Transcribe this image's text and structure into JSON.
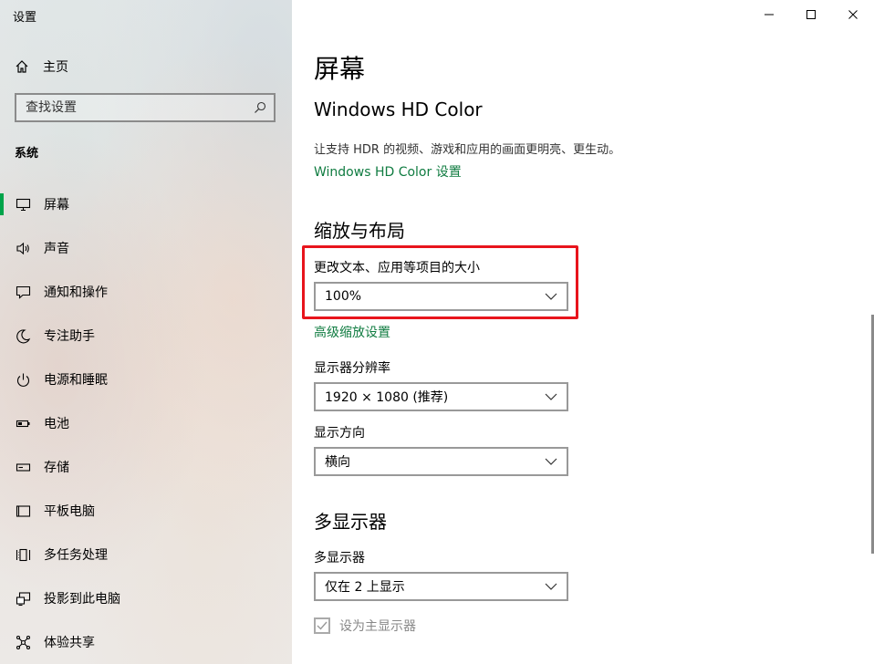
{
  "window": {
    "title": "设置"
  },
  "sidebar": {
    "home_label": "主页",
    "search_placeholder": "查找设置",
    "section": "系统",
    "items": [
      {
        "label": "屏幕",
        "icon": "monitor-icon",
        "active": true
      },
      {
        "label": "声音",
        "icon": "speaker-icon"
      },
      {
        "label": "通知和操作",
        "icon": "notification-icon"
      },
      {
        "label": "专注助手",
        "icon": "moon-icon"
      },
      {
        "label": "电源和睡眠",
        "icon": "power-icon"
      },
      {
        "label": "电池",
        "icon": "battery-icon"
      },
      {
        "label": "存储",
        "icon": "storage-icon"
      },
      {
        "label": "平板电脑",
        "icon": "tablet-icon"
      },
      {
        "label": "多任务处理",
        "icon": "multitask-icon"
      },
      {
        "label": "投影到此电脑",
        "icon": "project-icon"
      },
      {
        "label": "体验共享",
        "icon": "share-icon"
      }
    ]
  },
  "main": {
    "title": "屏幕",
    "hdr": {
      "heading": "Windows HD Color",
      "description": "让支持 HDR 的视频、游戏和应用的画面更明亮、更生动。",
      "link": "Windows HD Color 设置"
    },
    "scale": {
      "heading": "缩放与布局",
      "size_label": "更改文本、应用等项目的大小",
      "size_value": "100%",
      "advanced_link": "高级缩放设置",
      "resolution_label": "显示器分辨率",
      "resolution_value": "1920 × 1080 (推荐)",
      "orientation_label": "显示方向",
      "orientation_value": "横向"
    },
    "multi": {
      "heading": "多显示器",
      "label": "多显示器",
      "value": "仅在 2 上显示",
      "checkbox_label": "设为主显示器",
      "checkbox_checked": true
    }
  },
  "colors": {
    "accent": "#107c41",
    "highlight_border": "#e8141c",
    "active_indicator": "#00a44a"
  }
}
